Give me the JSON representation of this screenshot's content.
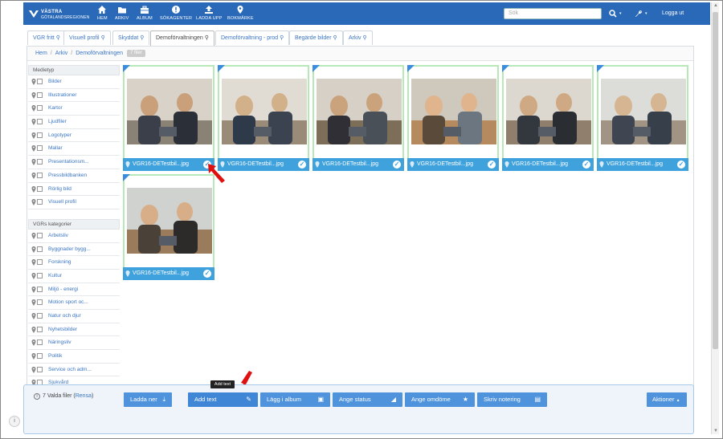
{
  "header": {
    "logo_line1": "VÄSTRA",
    "logo_line2": "GÖTALANDSREGIONEN",
    "nav": [
      {
        "label": "HEM",
        "icon": "home-icon"
      },
      {
        "label": "ARKIV",
        "icon": "folder-icon"
      },
      {
        "label": "ALBUM",
        "icon": "briefcase-icon"
      },
      {
        "label": "SÖKAGENTER",
        "icon": "alert-icon"
      },
      {
        "label": "LADDA UPP",
        "icon": "upload-icon"
      },
      {
        "label": "BOKMÄRKE",
        "icon": "map-pin-icon"
      }
    ],
    "search_placeholder": "Sök",
    "logout": "Logga ut"
  },
  "tabs": [
    {
      "label": "VGR fritt",
      "active": false
    },
    {
      "label": "Visuell profil",
      "active": false
    },
    {
      "label": "Skyddat",
      "active": false
    },
    {
      "label": "Demoförvaltningen",
      "active": true
    },
    {
      "label": "Demoförvaltning - prod",
      "active": false
    },
    {
      "label": "Begärde bilder",
      "active": false
    },
    {
      "label": "Arkiv",
      "active": false
    }
  ],
  "breadcrumb": {
    "items": [
      "Hem",
      "Arkiv",
      "Demoförvaltningen"
    ],
    "count": "7 filer"
  },
  "sidebar": {
    "section1": {
      "title": "Medietyp",
      "items": [
        "Bilder",
        "Illustrationer",
        "Kartor",
        "Ljudfiler",
        "Logotyper",
        "Mallar",
        "Presentationsm...",
        "Pressbildbanken",
        "Rörlig bild",
        "Visuell profil"
      ]
    },
    "section2": {
      "title": "VGRs kategorier",
      "items": [
        "Arbetsliv",
        "Byggnader bygg...",
        "Forskning",
        "Kultur",
        "Miljö - energi",
        "Motion sport oc...",
        "Natur och djur",
        "Nyhetsbilder",
        "Näringsliv",
        "Politik",
        "Service och adm...",
        "Sjukvård"
      ]
    }
  },
  "cards": [
    {
      "caption": "VGR16-DETestbil...jpg"
    },
    {
      "caption": "VGR16-DETestbil...jpg"
    },
    {
      "caption": "VGR16-DETestbil...jpg"
    },
    {
      "caption": "VGR16-DETestbil...jpg"
    },
    {
      "caption": "VGR16-DETestbil...jpg"
    },
    {
      "caption": "VGR16-DETestbil...jpg"
    },
    {
      "caption": "VGR16-DETestbil...jpg"
    }
  ],
  "bottombar": {
    "selected_text": "7 Valda filer (",
    "reset_link": "Rensa",
    "selected_close": ")",
    "buttons": [
      {
        "label": "Ladda ner",
        "icon": "download-icon"
      },
      {
        "label": "Add text",
        "icon": "pencil-icon"
      },
      {
        "label": "Lägg i album",
        "icon": "briefcase-icon"
      },
      {
        "label": "Ange status",
        "icon": "signal-icon"
      },
      {
        "label": "Ange omdöme",
        "icon": "star-icon"
      },
      {
        "label": "Skriv notering",
        "icon": "note-icon"
      }
    ],
    "actions": "Aktioner",
    "tooltip": "Add text"
  },
  "colors": {
    "header_blue": "#2a69b8",
    "button_blue": "#4f93dd",
    "caption_blue": "#3fa2dd",
    "selected_green": "#b8e8b8",
    "arrow_red": "#e01010"
  }
}
